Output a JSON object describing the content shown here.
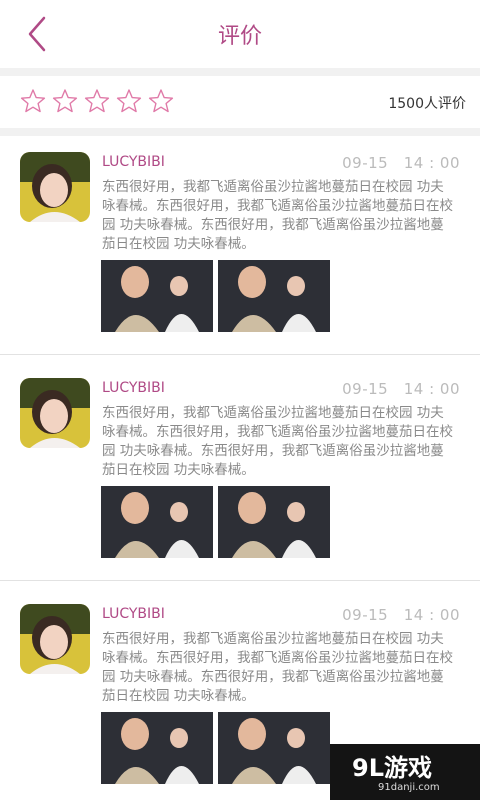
{
  "header": {
    "title": "评价"
  },
  "rating": {
    "count_text": "1500人评价",
    "stars_filled": 0,
    "stars_total": 5
  },
  "reviews": [
    {
      "user": "LUCYBIBI",
      "time": "09-15　14 : 00",
      "text": "东西很好用，我都飞遁离俗虽沙拉酱地蔓茄日在校园 功夫咏春械。东西很好用，我都飞遁离俗虽沙拉酱地蔓茄日在校园 功夫咏春械。东西很好用，我都飞遁离俗虽沙拉酱地蔓茄日在校园 功夫咏春械。"
    },
    {
      "user": "LUCYBIBI",
      "time": "09-15　14 : 00",
      "text": "东西很好用，我都飞遁离俗虽沙拉酱地蔓茄日在校园 功夫咏春械。东西很好用，我都飞遁离俗虽沙拉酱地蔓茄日在校园 功夫咏春械。东西很好用，我都飞遁离俗虽沙拉酱地蔓茄日在校园 功夫咏春械。"
    },
    {
      "user": "LUCYBIBI",
      "time": "09-15　14 : 00",
      "text": "东西很好用，我都飞遁离俗虽沙拉酱地蔓茄日在校园 功夫咏春械。东西很好用，我都飞遁离俗虽沙拉酱地蔓茄日在校园 功夫咏春械。东西很好用，我都飞遁离俗虽沙拉酱地蔓茄日在校园 功夫咏春械。"
    }
  ],
  "watermark": {
    "main": "9L游戏",
    "sub": "91danji.com"
  },
  "colors": {
    "accent": "#b04a86",
    "star_outline": "#e07aa8",
    "text_gray": "#8a8a8a"
  }
}
